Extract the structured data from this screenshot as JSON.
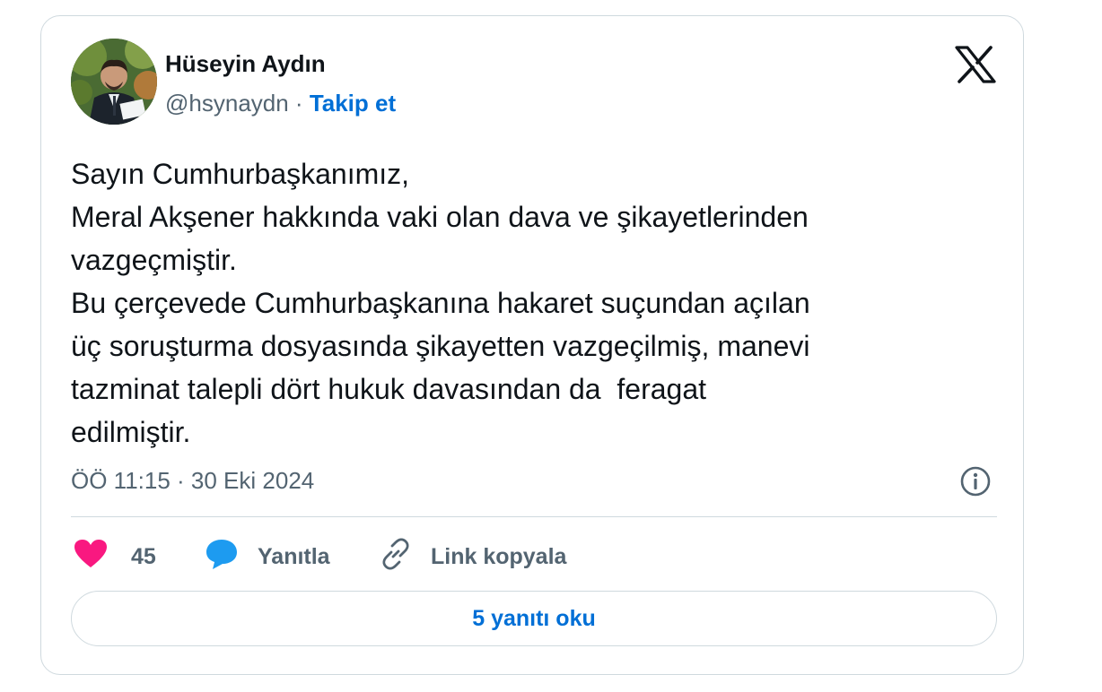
{
  "author": {
    "name": "Hüseyin Aydın",
    "handle": "@hsynaydn",
    "separator": " · ",
    "follow_label": "Takip et"
  },
  "tweet": {
    "lines": [
      "Sayın Cumhurbaşkanımız,",
      "Meral Akşener hakkında vaki olan dava ve şikayetlerinden",
      "vazgeçmiştir.",
      "Bu çerçevede Cumhurbaşkanına hakaret suçundan açılan",
      "üç soruşturma dosyasında şikayetten vazgeçilmiş, manevi",
      "tazminat talepli dört hukuk davasından da  feragat",
      "edilmiştir."
    ],
    "timestamp": "ÖÖ 11:15 · 30 Eki 2024"
  },
  "actions": {
    "like_count": "45",
    "reply_label": "Yanıtla",
    "copy_link_label": "Link kopyala"
  },
  "read_replies_label": "5 yanıtı oku",
  "icons": {
    "platform_logo": "x-logo-icon",
    "info": "info-icon",
    "like": "heart-icon",
    "reply": "speech-bubble-icon",
    "copy_link": "link-icon"
  },
  "colors": {
    "accent_link": "#006fd6",
    "heart": "#f91880",
    "reply_bubble": "#1d9bf0",
    "secondary_text": "#536471",
    "border": "#cfd9de"
  }
}
